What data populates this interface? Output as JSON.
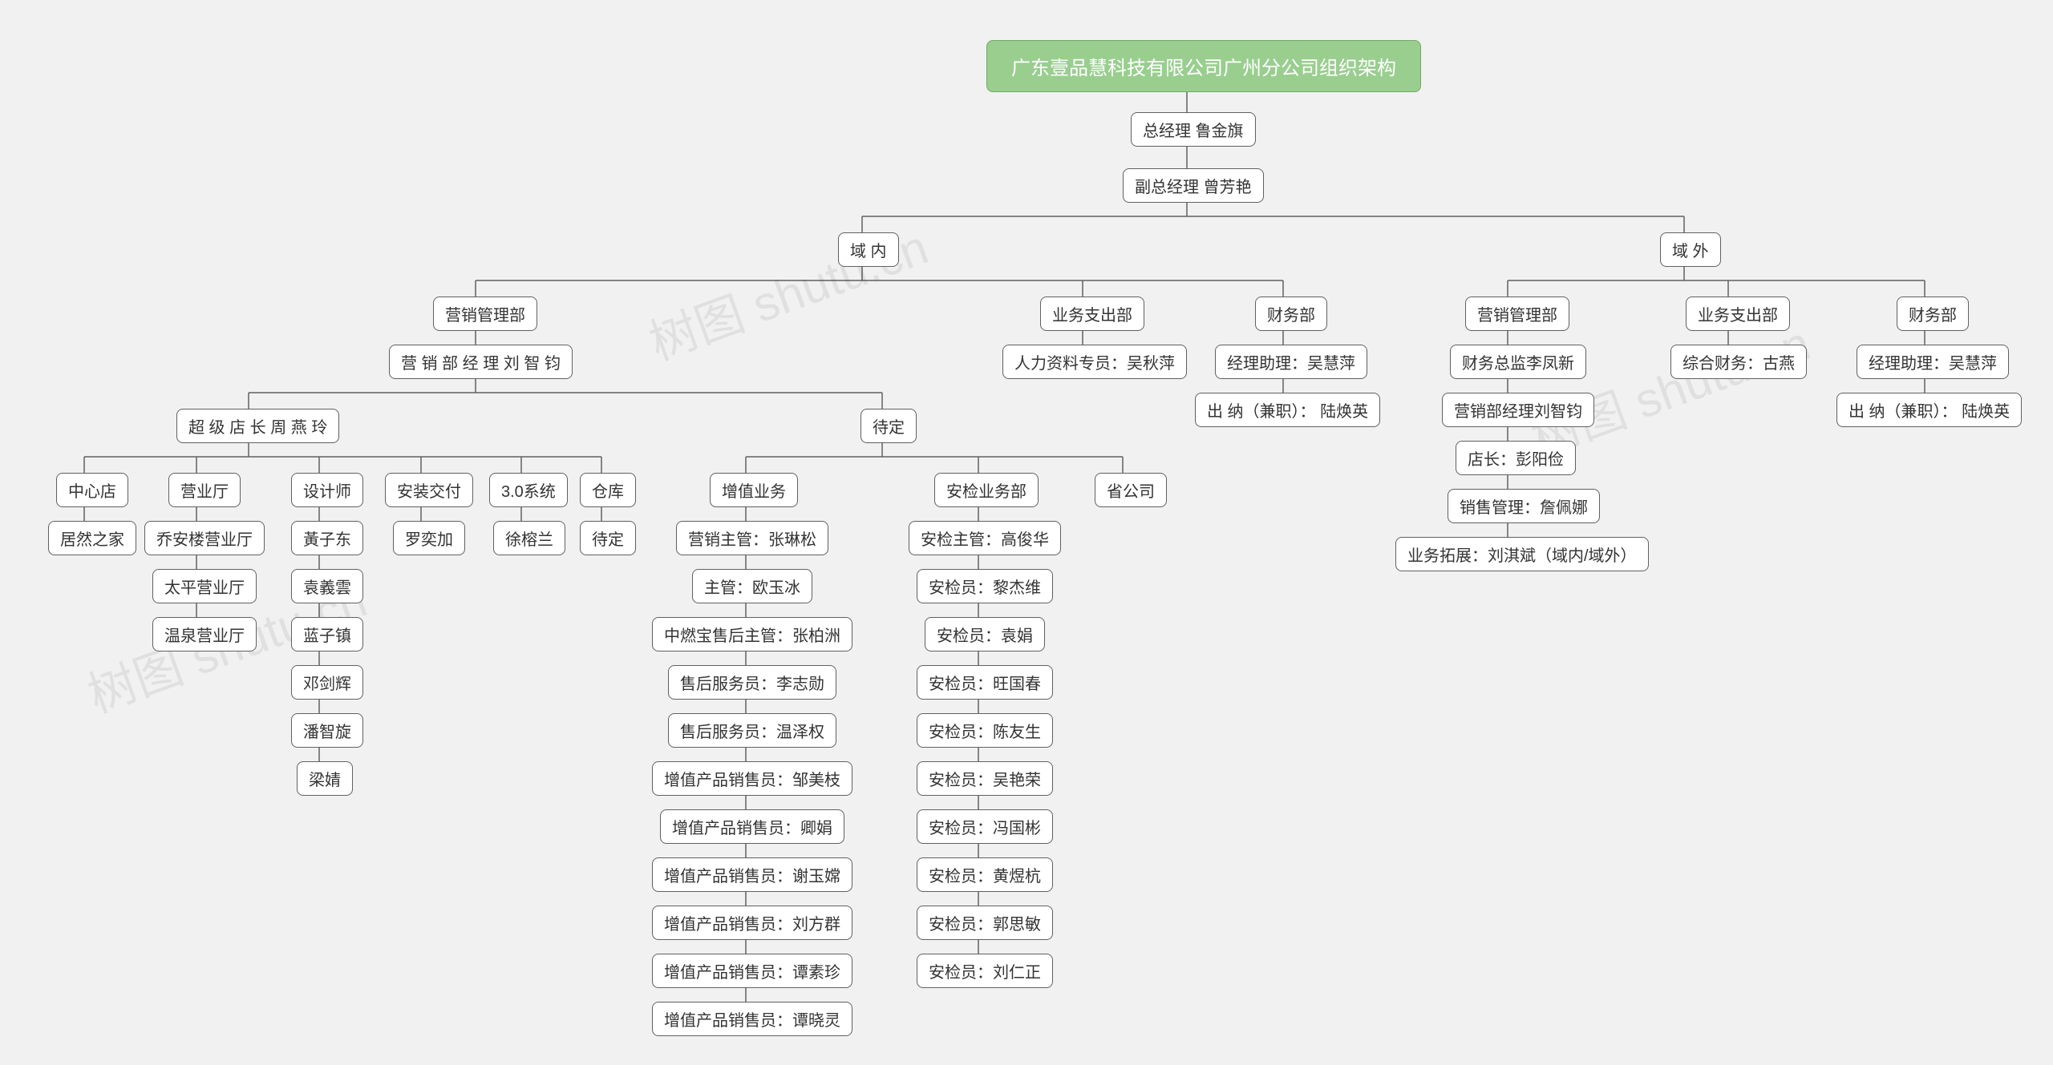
{
  "watermark": "树图 shutu.cn",
  "nodes": {
    "root": "广东壹品慧科技有限公司广州分公司组织架构",
    "gm": "总经理 鲁金旗",
    "dgm": "副总经理 曾芳艳",
    "yunei": "域 内",
    "yuwai": "域 外",
    "yn_mkt": "营销管理部",
    "yn_mkt_mgr": "营 销 部 经 理 刘 智 钧",
    "yn_biz": "业务支出部",
    "yn_biz_hr": "人力资料专员：吴秋萍",
    "yn_fin": "财务部",
    "yn_fin_asst": "经理助理：吴慧萍",
    "yn_fin_cash": "出 纳（兼职）： 陆焕英",
    "yw_mkt": "营销管理部",
    "yw_mkt_cfo": "财务总监李凤新",
    "yw_mkt_mgr": "营销部经理刘智钧",
    "yw_mkt_shop": "店长：彭阳俭",
    "yw_mkt_sales": "销售管理：詹佩娜",
    "yw_mkt_bizdev": "业务拓展：刘淇斌（域内/域外）",
    "yw_biz": "业务支出部",
    "yw_biz_fin": "综合财务：古燕",
    "yw_fin": "财务部",
    "yw_fin_asst": "经理助理：吴慧萍",
    "yw_fin_cash": "出 纳（兼职）： 陆焕英",
    "supershop": "超 级 店 长 周 燕 玲",
    "pending": "待定",
    "center": "中心店",
    "center_1": "居然之家",
    "hall": "营业厅",
    "hall_1": "乔安楼营业厅",
    "hall_2": "太平营业厅",
    "hall_3": "温泉营业厅",
    "designer": "设计师",
    "des_1": "黃子东",
    "des_2": "袁義雲",
    "des_3": "蓝子镇",
    "des_4": "邓剑辉",
    "des_5": "潘智旋",
    "des_6": "梁婧",
    "install": "安装交付",
    "install_1": "罗奕加",
    "sys30": "3.0系统",
    "sys30_1": "徐榕兰",
    "warehouse": "仓库",
    "warehouse_1": "待定",
    "vas": "增值业务",
    "vas_1": "营销主管：张琳松",
    "vas_2": "主管：欧玉冰",
    "vas_3": "中燃宝售后主管：张柏洲",
    "vas_4": "售后服务员：李志勋",
    "vas_5": "售后服务员：温泽权",
    "vas_6": "增值产品销售员：邹美枝",
    "vas_7": "增值产品销售员：卿娟",
    "vas_8": "增值产品销售员：谢玉嫦",
    "vas_9": "增值产品销售员：刘方群",
    "vas_10": "增值产品销售员：谭素珍",
    "vas_11": "增值产品销售员：谭晓灵",
    "insp": "安检业务部",
    "insp_1": "安检主管：高俊华",
    "insp_2": "安检员：黎杰维",
    "insp_3": "安检员：袁娟",
    "insp_4": "安检员：旺国春",
    "insp_5": "安检员：陈友生",
    "insp_6": "安检员：吴艳荣",
    "insp_7": "安检员：冯国彬",
    "insp_8": "安检员：黄煜杭",
    "insp_9": "安检员：郭思敏",
    "insp_10": "安检员：刘仁正",
    "prov": "省公司"
  },
  "chart_data": {
    "type": "tree",
    "title": "广东壹品慧科技有限公司广州分公司组织架构",
    "root": {
      "label": "广东壹品慧科技有限公司广州分公司组织架构",
      "children": [
        {
          "label": "总经理 鲁金旗",
          "children": [
            {
              "label": "副总经理 曾芳艳",
              "children": [
                {
                  "label": "域 内",
                  "children": [
                    {
                      "label": "营销管理部",
                      "children": [
                        {
                          "label": "营 销 部 经 理 刘 智 钧",
                          "children": [
                            {
                              "label": "超 级 店 长 周 燕 玲",
                              "children": [
                                {
                                  "label": "中心店",
                                  "children": [
                                    {
                                      "label": "居然之家"
                                    }
                                  ]
                                },
                                {
                                  "label": "营业厅",
                                  "children": [
                                    {
                                      "label": "乔安楼营业厅"
                                    },
                                    {
                                      "label": "太平营业厅"
                                    },
                                    {
                                      "label": "温泉营业厅"
                                    }
                                  ]
                                },
                                {
                                  "label": "设计师",
                                  "children": [
                                    {
                                      "label": "黃子东"
                                    },
                                    {
                                      "label": "袁義雲"
                                    },
                                    {
                                      "label": "蓝子镇"
                                    },
                                    {
                                      "label": "邓剑辉"
                                    },
                                    {
                                      "label": "潘智旋"
                                    },
                                    {
                                      "label": "梁婧"
                                    }
                                  ]
                                },
                                {
                                  "label": "安装交付",
                                  "children": [
                                    {
                                      "label": "罗奕加"
                                    }
                                  ]
                                },
                                {
                                  "label": "3.0系统",
                                  "children": [
                                    {
                                      "label": "徐榕兰"
                                    }
                                  ]
                                },
                                {
                                  "label": "仓库",
                                  "children": [
                                    {
                                      "label": "待定"
                                    }
                                  ]
                                }
                              ]
                            },
                            {
                              "label": "待定",
                              "children": [
                                {
                                  "label": "增值业务",
                                  "children": [
                                    {
                                      "label": "营销主管：张琳松"
                                    },
                                    {
                                      "label": "主管：欧玉冰"
                                    },
                                    {
                                      "label": "中燃宝售后主管：张柏洲"
                                    },
                                    {
                                      "label": "售后服务员：李志勋"
                                    },
                                    {
                                      "label": "售后服务员：温泽权"
                                    },
                                    {
                                      "label": "增值产品销售员：邹美枝"
                                    },
                                    {
                                      "label": "增值产品销售员：卿娟"
                                    },
                                    {
                                      "label": "增值产品销售员：谢玉嫦"
                                    },
                                    {
                                      "label": "增值产品销售员：刘方群"
                                    },
                                    {
                                      "label": "增值产品销售员：谭素珍"
                                    },
                                    {
                                      "label": "增值产品销售员：谭晓灵"
                                    }
                                  ]
                                },
                                {
                                  "label": "安检业务部",
                                  "children": [
                                    {
                                      "label": "安检主管：高俊华"
                                    },
                                    {
                                      "label": "安检员：黎杰维"
                                    },
                                    {
                                      "label": "安检员：袁娟"
                                    },
                                    {
                                      "label": "安检员：旺国春"
                                    },
                                    {
                                      "label": "安检员：陈友生"
                                    },
                                    {
                                      "label": "安检员：吴艳荣"
                                    },
                                    {
                                      "label": "安检员：冯国彬"
                                    },
                                    {
                                      "label": "安检员：黄煜杭"
                                    },
                                    {
                                      "label": "安检员：郭思敏"
                                    },
                                    {
                                      "label": "安检员：刘仁正"
                                    }
                                  ]
                                },
                                {
                                  "label": "省公司"
                                }
                              ]
                            }
                          ]
                        }
                      ]
                    },
                    {
                      "label": "业务支出部",
                      "children": [
                        {
                          "label": "人力资料专员：吴秋萍"
                        }
                      ]
                    },
                    {
                      "label": "财务部",
                      "children": [
                        {
                          "label": "经理助理：吴慧萍"
                        },
                        {
                          "label": "出 纳（兼职）： 陆焕英"
                        }
                      ]
                    }
                  ]
                },
                {
                  "label": "域 外",
                  "children": [
                    {
                      "label": "营销管理部",
                      "children": [
                        {
                          "label": "财务总监李凤新"
                        },
                        {
                          "label": "营销部经理刘智钧"
                        },
                        {
                          "label": "店长：彭阳俭"
                        },
                        {
                          "label": "销售管理：詹佩娜"
                        },
                        {
                          "label": "业务拓展：刘淇斌（域内/域外）"
                        }
                      ]
                    },
                    {
                      "label": "业务支出部",
                      "children": [
                        {
                          "label": "综合财务：古燕"
                        }
                      ]
                    },
                    {
                      "label": "财务部",
                      "children": [
                        {
                          "label": "经理助理：吴慧萍"
                        },
                        {
                          "label": "出 纳（兼职）： 陆焕英"
                        }
                      ]
                    }
                  ]
                }
              ]
            }
          ]
        }
      ]
    }
  }
}
